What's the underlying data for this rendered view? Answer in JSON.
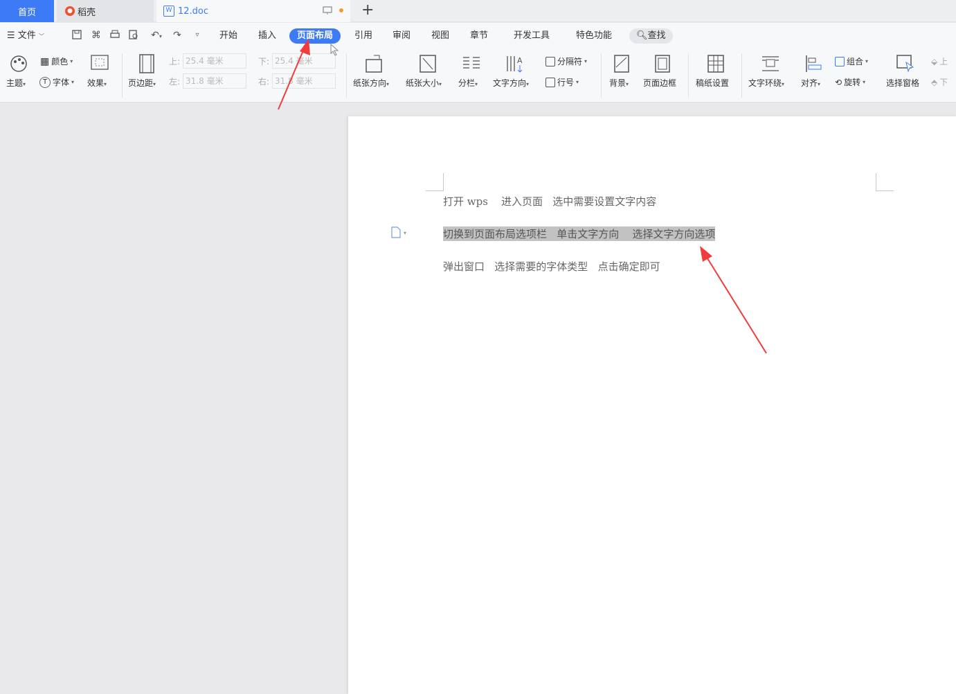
{
  "tabs": {
    "home": "首页",
    "daoke": "稻壳",
    "doc": "12.doc",
    "new_tab": "+"
  },
  "menu": {
    "file": "文件",
    "items": [
      "开始",
      "插入",
      "页面布局",
      "引用",
      "审阅",
      "视图",
      "章节",
      "开发工具",
      "特色功能"
    ],
    "search": "查找"
  },
  "ribbon": {
    "theme": "主题",
    "color": "颜色",
    "font": "字体",
    "effect": "效果",
    "margin": "页边距",
    "margin_top_label": "上:",
    "margin_top": "25.4 毫米",
    "margin_bottom_label": "下:",
    "margin_bottom": "25.4 毫米",
    "margin_left_label": "左:",
    "margin_left": "31.8 毫米",
    "margin_right_label": "右:",
    "margin_right": "31.8 毫米",
    "orientation": "纸张方向",
    "size": "纸张大小",
    "columns": "分栏",
    "text_direction": "文字方向",
    "break": "分隔符",
    "line_number": "行号",
    "background": "背景",
    "page_border": "页面边框",
    "paper_setup": "稿纸设置",
    "wrap": "文字环绕",
    "align": "对齐",
    "group": "组合",
    "rotate": "旋转",
    "select_pane": "选择窗格",
    "up": "上",
    "down": "下"
  },
  "document": {
    "lines": [
      "打开 wps    进入页面   选中需要设置文字内容",
      "切换到页面布局选项栏   单击文字方向    选择文字方向选项",
      "弹出窗口   选择需要的字体类型   点击确定即可"
    ]
  },
  "colors": {
    "accent": "#3d7af5",
    "annotation": "#f23b3b",
    "selection": "#c2c2c2"
  }
}
